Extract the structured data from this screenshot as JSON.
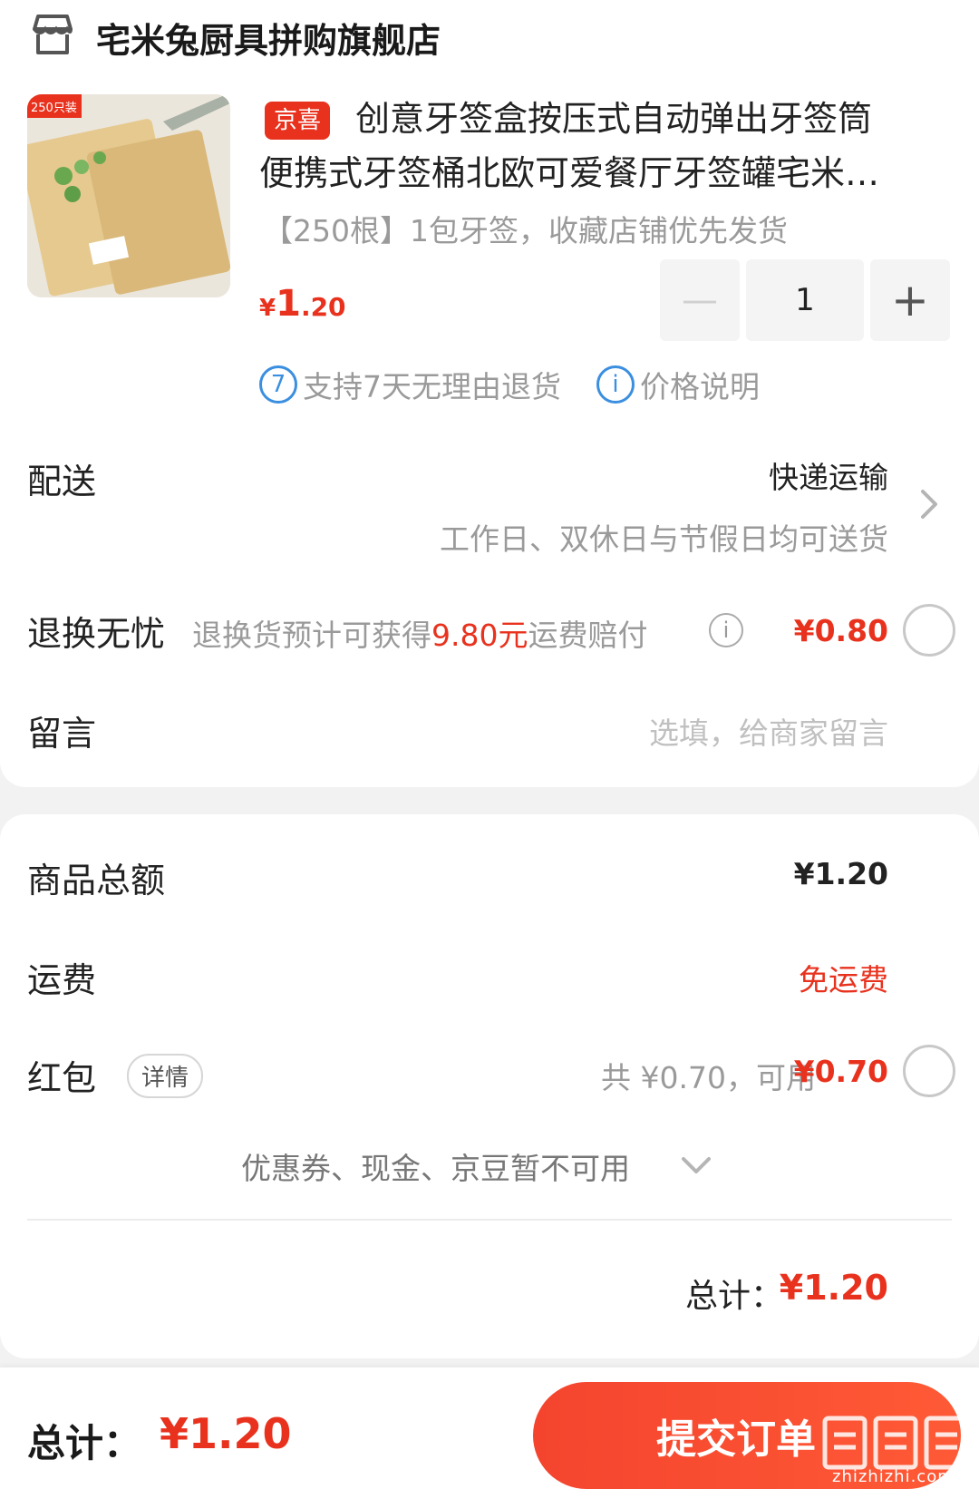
{
  "store": {
    "name": "宅米兔厨具拼购旗舰店",
    "icon": "store-icon"
  },
  "product": {
    "badge": "京喜",
    "title_line1": "创意牙签盒按压式自动弹出牙签筒",
    "title_line2": "便携式牙签桶北欧可爱餐厅牙签罐宅米…",
    "spec": "【250根】1包牙签，收藏店铺优先发货",
    "thumb_label": "250只装",
    "price_symbol": "¥",
    "price_int": "1",
    "price_dec": ".20",
    "quantity": "1",
    "minus_label": "—",
    "plus_label": "+",
    "service_return": "支持7天无理由退货",
    "service_return_icon": "7",
    "service_price": "价格说明",
    "service_price_icon": "i"
  },
  "delivery": {
    "label": "配送",
    "method": "快递运输",
    "note": "工作日、双休日与节假日均可送货"
  },
  "return_insurance": {
    "label": "退换无忧",
    "desc_prefix": "退换货预计可获得",
    "desc_amount": "9.80元",
    "desc_suffix": "运费赔付",
    "info_icon": "i",
    "price": "¥0.80"
  },
  "message": {
    "label": "留言",
    "placeholder": "选填，给商家留言"
  },
  "summary": {
    "goods_label": "商品总额",
    "goods_value": "¥1.20",
    "shipping_label": "运费",
    "shipping_value": "免运费",
    "hongbao_label": "红包",
    "hongbao_detail": "详情",
    "hongbao_total": "共 ¥0.70，可用",
    "hongbao_avail": "¥0.70",
    "coupon_note": "优惠券、现金、京豆暂不可用",
    "total_label": "总计：",
    "total_value": "¥1.20"
  },
  "footer": {
    "total_label": "总计：",
    "total_value": "¥1.20",
    "submit_label": "提交订单",
    "watermark_url": "zhizhizhi.com"
  },
  "colors": {
    "accent": "#e8321e",
    "info_blue": "#3b8fe0"
  }
}
